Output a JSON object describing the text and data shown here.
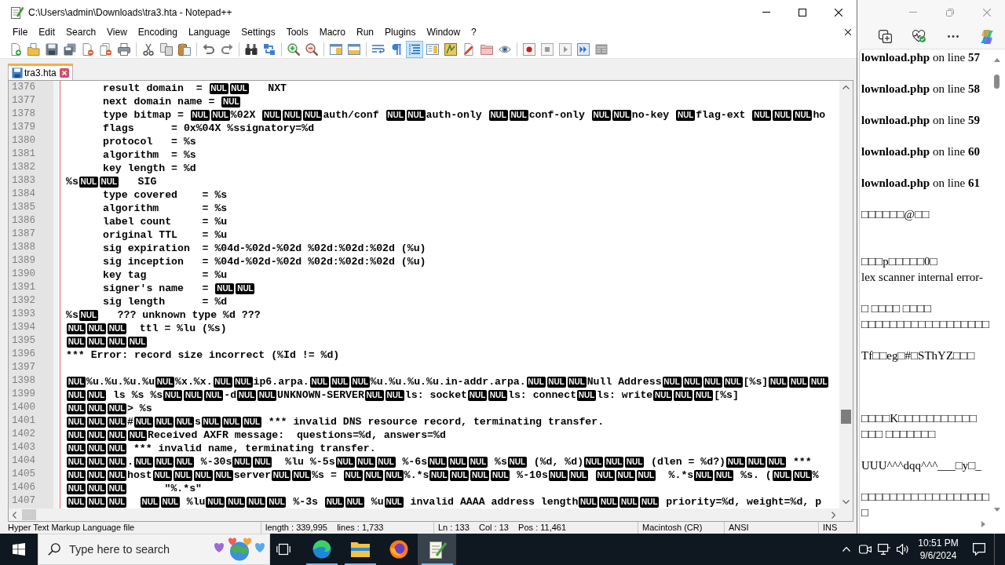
{
  "window": {
    "title": "C:\\Users\\admin\\Downloads\\tra3.hta - Notepad++"
  },
  "menu": [
    "File",
    "Edit",
    "Search",
    "View",
    "Encoding",
    "Language",
    "Settings",
    "Tools",
    "Macro",
    "Run",
    "Plugins",
    "Window",
    "?"
  ],
  "toolbar": [
    {
      "on": false
    },
    {
      "on": false
    },
    {
      "on": false
    },
    {
      "on": false
    },
    {
      "on": false
    },
    {
      "on": false
    },
    {
      "on": false
    },
    {
      "on": false
    },
    {
      "on": false
    },
    {
      "on": false
    },
    {
      "on": false
    },
    {
      "on": false
    },
    {
      "on": false
    },
    {
      "on": false
    },
    {
      "on": false
    },
    {
      "on": false
    },
    {
      "on": false
    },
    {
      "on": false
    },
    {
      "on": false
    },
    {
      "on": false
    },
    {
      "on": true
    },
    {
      "on": false
    },
    {
      "on": false
    },
    {
      "on": false
    },
    {
      "on": false
    },
    {
      "on": false
    },
    {
      "on": false
    },
    {
      "on": false
    },
    {
      "on": false
    },
    {
      "on": false
    },
    {
      "on": false
    }
  ],
  "tabs": [
    {
      "label": "tra3.hta",
      "selected": true
    }
  ],
  "editor": {
    "lines": [
      {
        "number": "1376",
        "segments": [
          {
            "kind": "tab"
          },
          {
            "kind": "text",
            "text": "result domain  = "
          },
          {
            "kind": "control",
            "text": "NUL"
          },
          {
            "kind": "control",
            "text": "NUL"
          },
          {
            "kind": "text",
            "text": "   NXT"
          }
        ]
      },
      {
        "number": "1377",
        "segments": [
          {
            "kind": "tab"
          },
          {
            "kind": "text",
            "text": "next domain name = "
          },
          {
            "kind": "control",
            "text": "NUL"
          }
        ]
      },
      {
        "number": "1378",
        "segments": [
          {
            "kind": "tab"
          },
          {
            "kind": "text",
            "text": "type bitmap = "
          },
          {
            "kind": "control",
            "text": "NUL"
          },
          {
            "kind": "control",
            "text": "NUL"
          },
          {
            "kind": "text",
            "text": "%02X "
          },
          {
            "kind": "control",
            "text": "NUL"
          },
          {
            "kind": "control",
            "text": "NUL"
          },
          {
            "kind": "control",
            "text": "NUL"
          },
          {
            "kind": "text",
            "text": "auth/conf "
          },
          {
            "kind": "control",
            "text": "NUL"
          },
          {
            "kind": "control",
            "text": "NUL"
          },
          {
            "kind": "text",
            "text": "auth-only "
          },
          {
            "kind": "control",
            "text": "NUL"
          },
          {
            "kind": "control",
            "text": "NUL"
          },
          {
            "kind": "text",
            "text": "conf-only "
          },
          {
            "kind": "control",
            "text": "NUL"
          },
          {
            "kind": "control",
            "text": "NUL"
          },
          {
            "kind": "text",
            "text": "no-key "
          },
          {
            "kind": "control",
            "text": "NUL"
          },
          {
            "kind": "text",
            "text": "flag-ext "
          },
          {
            "kind": "control",
            "text": "NUL"
          },
          {
            "kind": "control",
            "text": "NUL"
          },
          {
            "kind": "control",
            "text": "NUL"
          },
          {
            "kind": "text",
            "text": "ho"
          }
        ]
      },
      {
        "number": "1379",
        "segments": [
          {
            "kind": "tab"
          },
          {
            "kind": "text",
            "text": "flags      = 0x%04X %ssignatory=%d"
          }
        ]
      },
      {
        "number": "1380",
        "segments": [
          {
            "kind": "tab"
          },
          {
            "kind": "text",
            "text": "protocol   = %s"
          }
        ]
      },
      {
        "number": "1381",
        "segments": [
          {
            "kind": "tab"
          },
          {
            "kind": "text",
            "text": "algorithm  = %s"
          }
        ]
      },
      {
        "number": "1382",
        "segments": [
          {
            "kind": "tab"
          },
          {
            "kind": "text",
            "text": "key length = %d"
          }
        ]
      },
      {
        "number": "1383",
        "segments": [
          {
            "kind": "text",
            "text": "%s"
          },
          {
            "kind": "control",
            "text": "NUL"
          },
          {
            "kind": "control",
            "text": "NUL"
          },
          {
            "kind": "text",
            "text": "   SIG"
          }
        ]
      },
      {
        "number": "1384",
        "segments": [
          {
            "kind": "tab"
          },
          {
            "kind": "text",
            "text": "type covered    = %s"
          }
        ]
      },
      {
        "number": "1385",
        "segments": [
          {
            "kind": "tab"
          },
          {
            "kind": "text",
            "text": "algorithm       = %s"
          }
        ]
      },
      {
        "number": "1386",
        "segments": [
          {
            "kind": "tab"
          },
          {
            "kind": "text",
            "text": "label count     = %u"
          }
        ]
      },
      {
        "number": "1387",
        "segments": [
          {
            "kind": "tab"
          },
          {
            "kind": "text",
            "text": "original TTL    = %u"
          }
        ]
      },
      {
        "number": "1388",
        "segments": [
          {
            "kind": "tab"
          },
          {
            "kind": "text",
            "text": "sig expiration  = %04d-%02d-%02d %02d:%02d:%02d (%u)"
          }
        ]
      },
      {
        "number": "1389",
        "segments": [
          {
            "kind": "tab"
          },
          {
            "kind": "text",
            "text": "sig inception   = %04d-%02d-%02d %02d:%02d:%02d (%u)"
          }
        ]
      },
      {
        "number": "1390",
        "segments": [
          {
            "kind": "tab"
          },
          {
            "kind": "text",
            "text": "key tag         = %u"
          }
        ]
      },
      {
        "number": "1391",
        "segments": [
          {
            "kind": "tab"
          },
          {
            "kind": "text",
            "text": "signer's name   = "
          },
          {
            "kind": "control",
            "text": "NUL"
          },
          {
            "kind": "control",
            "text": "NUL"
          }
        ]
      },
      {
        "number": "1392",
        "segments": [
          {
            "kind": "tab"
          },
          {
            "kind": "text",
            "text": "sig length      = %d"
          }
        ]
      },
      {
        "number": "1393",
        "segments": [
          {
            "kind": "text",
            "text": "%s"
          },
          {
            "kind": "control",
            "text": "NUL"
          },
          {
            "kind": "text",
            "text": "   ??? unknown type %d ???"
          }
        ]
      },
      {
        "number": "1394",
        "segments": [
          {
            "kind": "control",
            "text": "NUL"
          },
          {
            "kind": "control",
            "text": "NUL"
          },
          {
            "kind": "control",
            "text": "NUL"
          },
          {
            "kind": "text",
            "text": "  ttl = %lu (%s)"
          }
        ]
      },
      {
        "number": "1395",
        "segments": [
          {
            "kind": "control",
            "text": "NUL"
          },
          {
            "kind": "control",
            "text": "NUL"
          },
          {
            "kind": "control",
            "text": "NUL"
          },
          {
            "kind": "control",
            "text": "NUL"
          }
        ]
      },
      {
        "number": "1396",
        "segments": [
          {
            "kind": "text",
            "text": "*** Error: record size incorrect (%Id != %d)"
          }
        ]
      },
      {
        "number": "1397"
      },
      {
        "number": "1398",
        "segments": [
          {
            "kind": "control",
            "text": "NUL"
          },
          {
            "kind": "text",
            "text": "%u.%u.%u.%u"
          },
          {
            "kind": "control",
            "text": "NUL"
          },
          {
            "kind": "text",
            "text": "%x.%x."
          },
          {
            "kind": "control",
            "text": "NUL"
          },
          {
            "kind": "control",
            "text": "NUL"
          },
          {
            "kind": "text",
            "text": "ip6.arpa."
          },
          {
            "kind": "control",
            "text": "NUL"
          },
          {
            "kind": "control",
            "text": "NUL"
          },
          {
            "kind": "control",
            "text": "NUL"
          },
          {
            "kind": "text",
            "text": "%u.%u.%u.%u.in-addr.arpa."
          },
          {
            "kind": "control",
            "text": "NUL"
          },
          {
            "kind": "control",
            "text": "NUL"
          },
          {
            "kind": "control",
            "text": "NUL"
          },
          {
            "kind": "text",
            "text": "Null Address"
          },
          {
            "kind": "control",
            "text": "NUL"
          },
          {
            "kind": "control",
            "text": "NUL"
          },
          {
            "kind": "control",
            "text": "NUL"
          },
          {
            "kind": "control",
            "text": "NUL"
          },
          {
            "kind": "text",
            "text": "[%s]"
          },
          {
            "kind": "control",
            "text": "NUL"
          },
          {
            "kind": "control",
            "text": "NUL"
          },
          {
            "kind": "control",
            "text": "NUL"
          }
        ]
      },
      {
        "number": "1399",
        "segments": [
          {
            "kind": "control",
            "text": "NUL"
          },
          {
            "kind": "control",
            "text": "NUL"
          },
          {
            "kind": "text",
            "text": " ls %s %s"
          },
          {
            "kind": "control",
            "text": "NUL"
          },
          {
            "kind": "control",
            "text": "NUL"
          },
          {
            "kind": "control",
            "text": "NUL"
          },
          {
            "kind": "text",
            "text": "-d"
          },
          {
            "kind": "control",
            "text": "NUL"
          },
          {
            "kind": "control",
            "text": "NUL"
          },
          {
            "kind": "text",
            "text": "UNKNOWN-SERVER"
          },
          {
            "kind": "control",
            "text": "NUL"
          },
          {
            "kind": "control",
            "text": "NUL"
          },
          {
            "kind": "text",
            "text": "ls: socket"
          },
          {
            "kind": "control",
            "text": "NUL"
          },
          {
            "kind": "control",
            "text": "NUL"
          },
          {
            "kind": "text",
            "text": "ls: connect"
          },
          {
            "kind": "control",
            "text": "NUL"
          },
          {
            "kind": "text",
            "text": "ls: write"
          },
          {
            "kind": "control",
            "text": "NUL"
          },
          {
            "kind": "control",
            "text": "NUL"
          },
          {
            "kind": "control",
            "text": "NUL"
          },
          {
            "kind": "text",
            "text": "[%s]"
          }
        ]
      },
      {
        "number": "1400",
        "segments": [
          {
            "kind": "control",
            "text": "NUL"
          },
          {
            "kind": "control",
            "text": "NUL"
          },
          {
            "kind": "control",
            "text": "NUL"
          },
          {
            "kind": "text",
            "text": "> %s"
          }
        ]
      },
      {
        "number": "1401",
        "segments": [
          {
            "kind": "control",
            "text": "NUL"
          },
          {
            "kind": "control",
            "text": "NUL"
          },
          {
            "kind": "control",
            "text": "NUL"
          },
          {
            "kind": "text",
            "text": "#"
          },
          {
            "kind": "control",
            "text": "NUL"
          },
          {
            "kind": "control",
            "text": "NUL"
          },
          {
            "kind": "control",
            "text": "NUL"
          },
          {
            "kind": "text",
            "text": "s"
          },
          {
            "kind": "control",
            "text": "NUL"
          },
          {
            "kind": "control",
            "text": "NUL"
          },
          {
            "kind": "control",
            "text": "NUL"
          },
          {
            "kind": "text",
            "text": " *** invalid DNS resource record, terminating transfer."
          }
        ]
      },
      {
        "number": "1402",
        "segments": [
          {
            "kind": "control",
            "text": "NUL"
          },
          {
            "kind": "control",
            "text": "NUL"
          },
          {
            "kind": "control",
            "text": "NUL"
          },
          {
            "kind": "control",
            "text": "NUL"
          },
          {
            "kind": "text",
            "text": "Received AXFR message:  questions=%d, answers=%d"
          }
        ]
      },
      {
        "number": "1403",
        "segments": [
          {
            "kind": "control",
            "text": "NUL"
          },
          {
            "kind": "control",
            "text": "NUL"
          },
          {
            "kind": "control",
            "text": "NUL"
          },
          {
            "kind": "text",
            "text": " *** invalid name, terminating transfer."
          }
        ]
      },
      {
        "number": "1404",
        "segments": [
          {
            "kind": "control",
            "text": "NUL"
          },
          {
            "kind": "control",
            "text": "NUL"
          },
          {
            "kind": "control",
            "text": "NUL"
          },
          {
            "kind": "text",
            "text": "."
          },
          {
            "kind": "control",
            "text": "NUL"
          },
          {
            "kind": "control",
            "text": "NUL"
          },
          {
            "kind": "control",
            "text": "NUL"
          },
          {
            "kind": "text",
            "text": " %-30s"
          },
          {
            "kind": "control",
            "text": "NUL"
          },
          {
            "kind": "control",
            "text": "NUL"
          },
          {
            "kind": "text",
            "text": "  %lu %-5s"
          },
          {
            "kind": "control",
            "text": "NUL"
          },
          {
            "kind": "control",
            "text": "NUL"
          },
          {
            "kind": "control",
            "text": "NUL"
          },
          {
            "kind": "text",
            "text": " %-6s"
          },
          {
            "kind": "control",
            "text": "NUL"
          },
          {
            "kind": "control",
            "text": "NUL"
          },
          {
            "kind": "control",
            "text": "NUL"
          },
          {
            "kind": "text",
            "text": " %s"
          },
          {
            "kind": "control",
            "text": "NUL"
          },
          {
            "kind": "text",
            "text": " (%d, %d)"
          },
          {
            "kind": "control",
            "text": "NUL"
          },
          {
            "kind": "control",
            "text": "NUL"
          },
          {
            "kind": "control",
            "text": "NUL"
          },
          {
            "kind": "text",
            "text": " (dlen = %d?)"
          },
          {
            "kind": "control",
            "text": "NUL"
          },
          {
            "kind": "control",
            "text": "NUL"
          },
          {
            "kind": "control",
            "text": "NUL"
          },
          {
            "kind": "text",
            "text": " ***"
          }
        ]
      },
      {
        "number": "1405",
        "segments": [
          {
            "kind": "control",
            "text": "NUL"
          },
          {
            "kind": "control",
            "text": "NUL"
          },
          {
            "kind": "control",
            "text": "NUL"
          },
          {
            "kind": "text",
            "text": "host"
          },
          {
            "kind": "control",
            "text": "NUL"
          },
          {
            "kind": "control",
            "text": "NUL"
          },
          {
            "kind": "control",
            "text": "NUL"
          },
          {
            "kind": "control",
            "text": "NUL"
          },
          {
            "kind": "text",
            "text": "server"
          },
          {
            "kind": "control",
            "text": "NUL"
          },
          {
            "kind": "control",
            "text": "NUL"
          },
          {
            "kind": "text",
            "text": "%s = "
          },
          {
            "kind": "control",
            "text": "NUL"
          },
          {
            "kind": "control",
            "text": "NUL"
          },
          {
            "kind": "control",
            "text": "NUL"
          },
          {
            "kind": "text",
            "text": "%.*s"
          },
          {
            "kind": "control",
            "text": "NUL"
          },
          {
            "kind": "control",
            "text": "NUL"
          },
          {
            "kind": "control",
            "text": "NUL"
          },
          {
            "kind": "control",
            "text": "NUL"
          },
          {
            "kind": "text",
            "text": " %-10s"
          },
          {
            "kind": "control",
            "text": "NUL"
          },
          {
            "kind": "control",
            "text": "NUL"
          },
          {
            "kind": "space"
          },
          {
            "kind": "control",
            "text": "NUL"
          },
          {
            "kind": "control",
            "text": "NUL"
          },
          {
            "kind": "control",
            "text": "NUL"
          },
          {
            "kind": "text",
            "text": "  %.*s"
          },
          {
            "kind": "control",
            "text": "NUL"
          },
          {
            "kind": "control",
            "text": "NUL"
          },
          {
            "kind": "text",
            "text": " %s. ("
          },
          {
            "kind": "control",
            "text": "NUL"
          },
          {
            "kind": "control",
            "text": "NUL"
          },
          {
            "kind": "text",
            "text": "%"
          }
        ]
      },
      {
        "number": "1406",
        "segments": [
          {
            "kind": "control",
            "text": "NUL"
          },
          {
            "kind": "control",
            "text": "NUL"
          },
          {
            "kind": "control",
            "text": "NUL"
          },
          {
            "kind": "text",
            "text": "      \"%.*s\""
          }
        ]
      },
      {
        "number": "1407",
        "segments": [
          {
            "kind": "control",
            "text": "NUL"
          },
          {
            "kind": "control",
            "text": "NUL"
          },
          {
            "kind": "control",
            "text": "NUL"
          },
          {
            "kind": "space"
          },
          {
            "kind": "space"
          },
          {
            "kind": "control",
            "text": "NUL"
          },
          {
            "kind": "control",
            "text": "NUL"
          },
          {
            "kind": "text",
            "text": " %lu"
          },
          {
            "kind": "control",
            "text": "NUL"
          },
          {
            "kind": "control",
            "text": "NUL"
          },
          {
            "kind": "control",
            "text": "NUL"
          },
          {
            "kind": "control",
            "text": "NUL"
          },
          {
            "kind": "text",
            "text": " %-3s "
          },
          {
            "kind": "control",
            "text": "NUL"
          },
          {
            "kind": "control",
            "text": "NUL"
          },
          {
            "kind": "text",
            "text": " %u"
          },
          {
            "kind": "control",
            "text": "NUL"
          },
          {
            "kind": "text",
            "text": " invalid AAAA address length"
          },
          {
            "kind": "control",
            "text": "NUL"
          },
          {
            "kind": "control",
            "text": "NUL"
          },
          {
            "kind": "control",
            "text": "NUL"
          },
          {
            "kind": "control",
            "text": "NUL"
          },
          {
            "kind": "text",
            "text": " priority=%d, weight=%d, p"
          }
        ]
      }
    ]
  },
  "status_bar": [
    "Hyper Text Markup Language file",
    "length : 339,995    lines : 1,733",
    "Ln : 133    Col : 13    Pos : 11,461",
    "Macintosh (CR)",
    "ANSI",
    "INS"
  ],
  "browser": {
    "paragraphs": [
      {
        "lines": [
          "**lownload.php** on line **57**"
        ]
      },
      {
        "lines": [
          "**lownload.php** on line **58**"
        ]
      },
      {
        "lines": [
          "**lownload.php** on line **59**"
        ]
      },
      {
        "lines": [
          "**lownload.php** on line **60**"
        ]
      },
      {
        "lines": [
          "**lownload.php** on line **61**"
        ]
      },
      {
        "lines": [
          "□□□□□□@□□"
        ]
      },
      {
        "lines": [
          "□□□p□□□□□0□",
          "lex scanner internal error-"
        ]
      },
      {
        "lines": [
          "□ □□□□ □□□□",
          "□□□□□□□□□□□□□□□□□□"
        ]
      },
      {
        "lines": [
          "Tf□□eg□#□SThYZ□□□"
        ]
      },
      {
        "lines": [
          "□□□□K□□□□□□□□□□□",
          "□□□ □□□□□□□"
        ]
      },
      {
        "lines": [
          "UUU^^^dqq^^^___□y□_"
        ]
      },
      {
        "lines": [
          "□□□□□□□□□□□□□□□□□□",
          "□"
        ]
      }
    ]
  },
  "taskbar": {
    "search": {
      "placeholder": "Type here to search"
    },
    "apps": [
      {
        "running": true,
        "selected": false
      },
      {
        "running": true,
        "selected": false
      },
      {
        "running": false,
        "selected": false
      },
      {
        "running": true,
        "selected": true
      }
    ],
    "clock": {
      "time": "10:51 PM",
      "date": "9/6/2024"
    }
  }
}
